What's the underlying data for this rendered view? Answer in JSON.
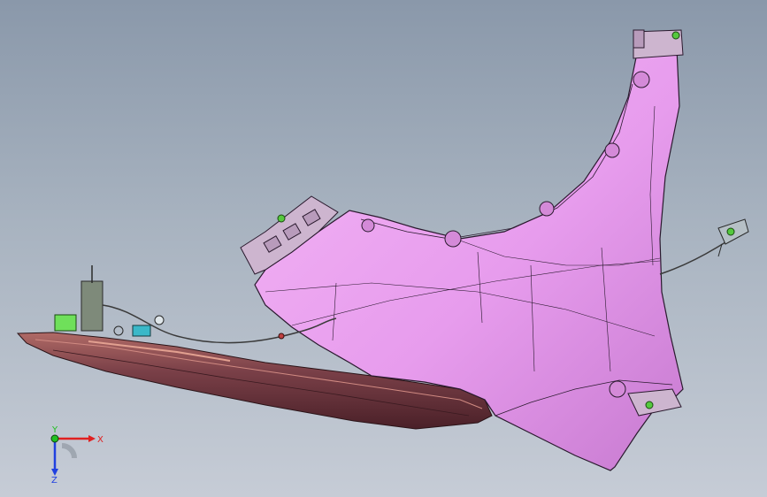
{
  "viewport": {
    "background_top": "#8a98aa",
    "background_bottom": "#c6ccd6"
  },
  "model": {
    "fender_color": "#e79ced",
    "fender_edge_color": "#2a1a2e",
    "trim_color": "#7a4048",
    "trim_highlight": "#b06a66",
    "bracket_color": "#cdb5cf",
    "cable_color": "#3a3a3a",
    "clip_color": "#55c93e"
  },
  "triad": {
    "x_label": "X",
    "y_label": "Y",
    "z_label": "Z",
    "x_color": "#e02020",
    "y_color": "#20c020",
    "z_color": "#2040e0"
  }
}
